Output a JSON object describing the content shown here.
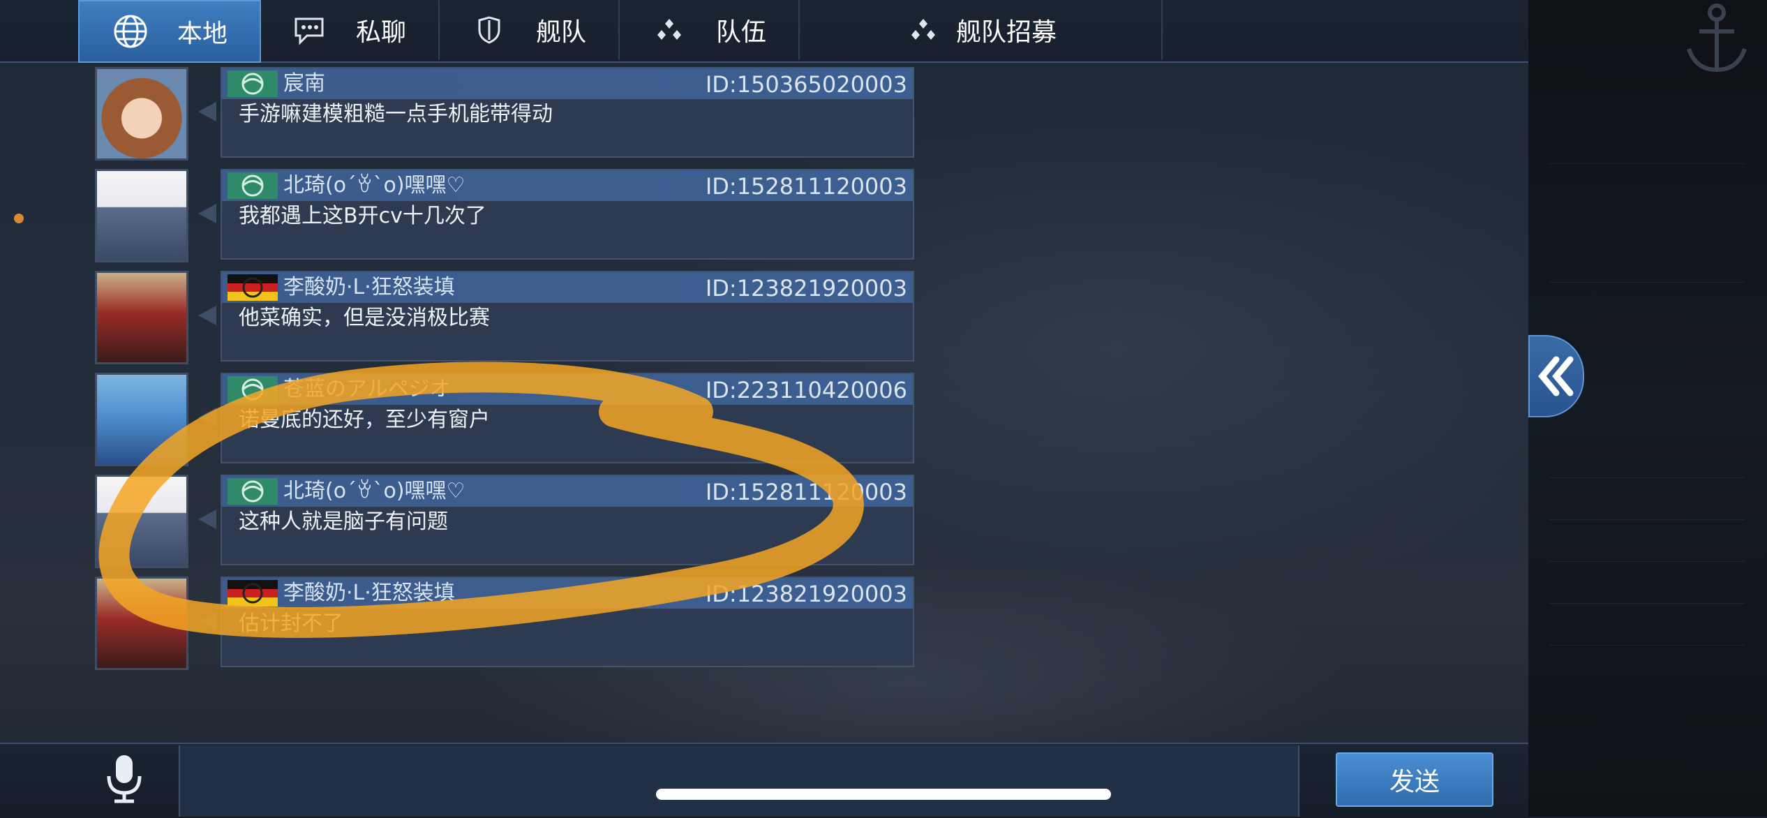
{
  "tabs": [
    {
      "label": "本地",
      "icon": "globe-icon",
      "active": true
    },
    {
      "label": "私聊",
      "icon": "chat-bubble-icon",
      "active": false
    },
    {
      "label": "舰队",
      "icon": "shield-icon",
      "active": false
    },
    {
      "label": "队伍",
      "icon": "team-icon",
      "active": false
    },
    {
      "label": "舰队招募",
      "icon": "team-icon",
      "active": false
    }
  ],
  "messages": [
    {
      "name": "宸南",
      "id": "ID:150365020003",
      "text": "手游嘛建模粗糙一点手机能带得动",
      "flag": "green-emblem"
    },
    {
      "name": "北琦(o´ꈊ`o)嘿嘿♡",
      "id": "ID:152811120003",
      "text": "我都遇上这B开cv十几次了",
      "flag": "green-emblem"
    },
    {
      "name": "李酸奶·L·狂怒装填",
      "id": "ID:123821920003",
      "text": "他菜确实，但是没消极比赛",
      "flag": "german-flag"
    },
    {
      "name": "苍蓝のアルペジオ",
      "id": "ID:223110420006",
      "text": "诺曼底的还好，至少有窗户",
      "flag": "green-emblem"
    },
    {
      "name": "北琦(o´ꈊ`o)嘿嘿♡",
      "id": "ID:152811120003",
      "text": "这种人就是脑子有问题",
      "flag": "green-emblem"
    },
    {
      "name": "李酸奶·L·狂怒装填",
      "id": "ID:123821920003",
      "text": "估计封不了",
      "flag": "german-flag"
    }
  ],
  "bottom": {
    "send_label": "发送",
    "input_value": ""
  },
  "colors": {
    "accent": "#3f7ec0",
    "highlight_scribble": "#f5a623",
    "notification_dot": "#d88a34"
  }
}
